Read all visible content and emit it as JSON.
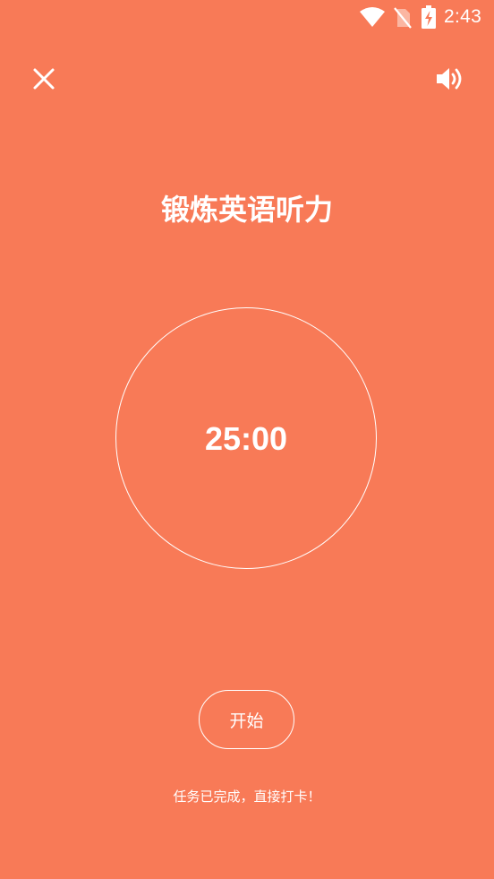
{
  "status_bar": {
    "time": "2:43",
    "icons": [
      "wifi-icon",
      "no-sim-icon",
      "battery-charging-icon"
    ]
  },
  "toolbar": {
    "close_icon": "close-icon",
    "sound_icon": "volume-icon"
  },
  "task": {
    "title": "锻炼英语听力"
  },
  "timer": {
    "display": "25:00"
  },
  "actions": {
    "start_label": "开始",
    "checkin_hint": "任务已完成，直接打卡！"
  },
  "colors": {
    "background": "#F87A57",
    "foreground": "#FFFFFF"
  }
}
